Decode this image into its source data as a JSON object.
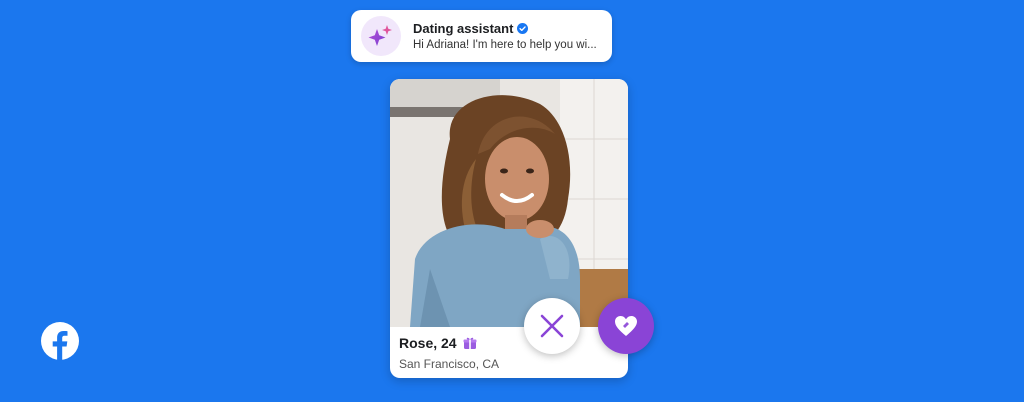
{
  "notification": {
    "title": "Dating assistant",
    "message": "Hi Adriana! I'm here to help you wi..."
  },
  "profile": {
    "name_age": "Rose, 24",
    "location": "San Francisco, CA"
  },
  "icons": {
    "assistant": "sparkle-icon",
    "verified": "verified-badge-icon",
    "gift": "gift-icon",
    "pass": "close-icon",
    "like": "heart-icon",
    "brand": "facebook-logo"
  },
  "colors": {
    "background": "#1b77ee",
    "accent_purple": "#8a44d6",
    "verified_blue": "#1877f2"
  }
}
